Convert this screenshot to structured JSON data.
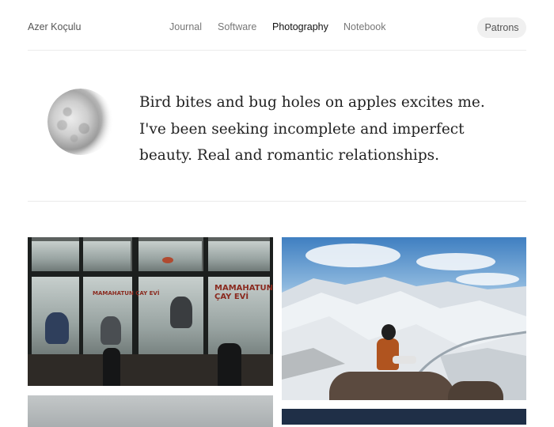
{
  "header": {
    "site_title": "Azer Koçulu",
    "nav": [
      {
        "label": "Journal",
        "active": false
      },
      {
        "label": "Software",
        "active": false
      },
      {
        "label": "Photography",
        "active": true
      },
      {
        "label": "Notebook",
        "active": false
      }
    ],
    "patrons_label": "Patrons"
  },
  "intro": {
    "bio": "Bird bites and bug holes on apples excites me. I've been seeking incomplete and imperfect beauty. Real and romantic relationships."
  },
  "photos": [
    {
      "subject": "teahouse-window",
      "sign_text": "MAMAHATUN ÇAY EVİ"
    },
    {
      "subject": "snowy-mountains-hiker"
    },
    {
      "subject": "partial-bottom-left"
    },
    {
      "subject": "partial-bottom-right"
    }
  ],
  "colors": {
    "background": "#ffffff",
    "text_primary": "#222222",
    "nav_inactive": "#777777",
    "patrons_bg": "#f0f0f0",
    "divider": "#ebebeb"
  }
}
